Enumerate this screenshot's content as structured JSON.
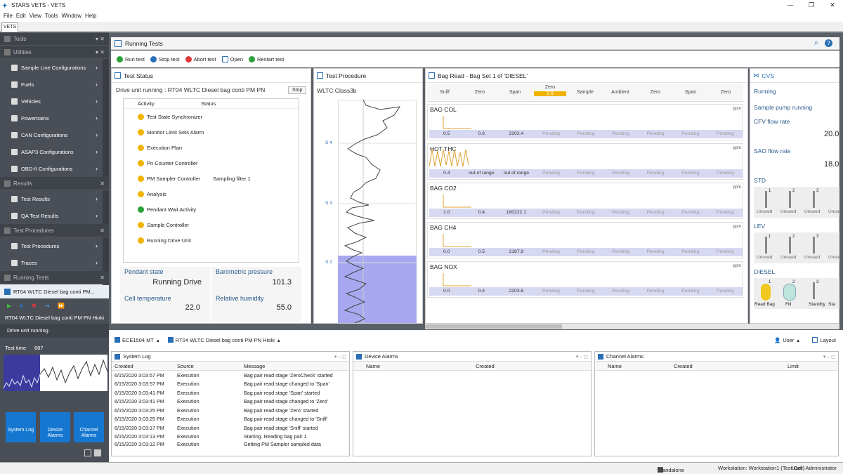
{
  "window": {
    "title": "STARS VETS - VETS",
    "tab": "VETS"
  },
  "menu": [
    "File",
    "Edit",
    "View",
    "Tools",
    "Window",
    "Help"
  ],
  "left": {
    "tools_header": "Tools",
    "utilities_header": "Utilities",
    "utilities": [
      "Sample Line Configurations",
      "Fuels",
      "Vehicles",
      "Powertrains",
      "CAN Configurations",
      "ASAP3 Configurations",
      "OBD-II Configurations"
    ],
    "results_header": "Results",
    "results": [
      "Test Results",
      "QA Test Results"
    ],
    "procedures_header": "Test Procedures",
    "procedures": [
      "Test Procedures",
      "Traces"
    ],
    "running_header": "Running Tests",
    "running_item": "RT04 WLTC Diesel bag conti PM...",
    "running_title": "RT04 WLTC Diesel bag conti PM PN Hioki",
    "drive_status": "Drive unit running",
    "test_time_label": "Test time",
    "test_time_value": "687",
    "buttons": {
      "system_log": "System Log",
      "device_alarms": "Device Alarms",
      "channel_alarms": "Channel Alarms"
    }
  },
  "running": {
    "title": "Running Tests",
    "toolbar": {
      "run": "Run test",
      "stop": "Stop test",
      "abort": "Abort test",
      "open": "Open",
      "restart": "Restart test"
    }
  },
  "test_status": {
    "title": "Test Status",
    "headline": "Drive unit running : RT04 WLTC Diesel bag conti PM PN",
    "stop_label": "Stop",
    "col_activity": "Activity",
    "col_status": "Status",
    "activities": [
      {
        "name": "Test State Synchronizer",
        "status": ""
      },
      {
        "name": "Monitor Limit Sets Alarm",
        "status": ""
      },
      {
        "name": "Execution Plan",
        "status": ""
      },
      {
        "name": "Pn Counter Controller",
        "status": ""
      },
      {
        "name": "PM Sampler Controller",
        "status": "Sampling filter 1"
      },
      {
        "name": "Analysis",
        "status": ""
      },
      {
        "name": "Pendant Wait Activity",
        "status": ""
      },
      {
        "name": "Sample Controller",
        "status": ""
      },
      {
        "name": "Running Drive Unit",
        "status": ""
      }
    ],
    "pendant_label": "Pendant state",
    "pendant_value": "Running Drive",
    "baro_label": "Barometric pressure",
    "baro_value": "101.3",
    "cell_temp_label": "Cell temperature",
    "cell_temp_value": "22.0",
    "humidity_label": "Relative humidity",
    "humidity_value": "55.0"
  },
  "procedure": {
    "title": "Test Procedure",
    "cycle": "WLTC Class3b",
    "markers": [
      "S 4",
      "S 3",
      "S 2"
    ]
  },
  "bag_read": {
    "title": "Bag Read - Bag Set 1 of 'DIESEL'",
    "columns": [
      "Sniff",
      "Zero",
      "Span",
      "Zero",
      "Sample",
      "Ambient",
      "Zero",
      "Span",
      "Zero"
    ],
    "active_badge": "2.9",
    "unit": "ppm",
    "rows": [
      {
        "name": "BAG COL",
        "values": [
          "0.5",
          "0.6",
          "2202.4",
          "Pending",
          "Pending",
          "Pending",
          "Pending",
          "Pending",
          "Pending"
        ]
      },
      {
        "name": "HOT THC",
        "values": [
          "0.4",
          "out of range",
          "out of range",
          "Pending",
          "Pending",
          "Pending",
          "Pending",
          "Pending",
          "Pending"
        ]
      },
      {
        "name": "BAG CO2",
        "values": [
          "1.0",
          "0.4",
          "180222.1",
          "Pending",
          "Pending",
          "Pending",
          "Pending",
          "Pending",
          "Pending"
        ]
      },
      {
        "name": "BAG CH4",
        "values": [
          "0.0",
          "0.5",
          "2187.9",
          "Pending",
          "Pending",
          "Pending",
          "Pending",
          "Pending",
          "Pending"
        ]
      },
      {
        "name": "BAG NOX",
        "values": [
          "0.0",
          "0.4",
          "2203.8",
          "Pending",
          "Pending",
          "Pending",
          "Pending",
          "Pending",
          "Pending"
        ]
      }
    ]
  },
  "cvs": {
    "title": "CVS",
    "status": "Running",
    "pump": "Sample pump running",
    "cfv_label": "CFV flow rate",
    "cfv_value": "20.0",
    "sao_label": "SAO flow rate",
    "sao_value": "18.0",
    "std_label": "STD",
    "lev_label": "LEV",
    "diesel_label": "DIESEL",
    "unused": "Unused",
    "slot_numbers": [
      "1",
      "2",
      "3"
    ],
    "diesel_bags": [
      "Read Bag",
      "Fill",
      "Standby",
      "Sta"
    ]
  },
  "bottom": {
    "ece": "ECE1504 MT",
    "test": "RT04 WLTC Diesel bag conti PM PN Hioki",
    "user": "User",
    "layout": "Layout"
  },
  "system_log": {
    "title": "System Log",
    "cols": [
      "Created",
      "Source",
      "Message"
    ],
    "rows": [
      [
        "6/15/2020 3:03:57 PM",
        "Execution",
        "Bag pair read stage 'ZeroCheck' started"
      ],
      [
        "6/15/2020 3:03:57 PM",
        "Execution",
        "Bag pair read stage changed to 'Span'"
      ],
      [
        "6/15/2020 3:03:41 PM",
        "Execution",
        "Bag pair read stage 'Span' started"
      ],
      [
        "6/15/2020 3:03:41 PM",
        "Execution",
        "Bag pair read stage changed to 'Zero'"
      ],
      [
        "6/15/2020 3:03:25 PM",
        "Execution",
        "Bag pair read stage 'Zero' started"
      ],
      [
        "6/15/2020 3:03:25 PM",
        "Execution",
        "Bag pair read stage changed to 'Sniff'"
      ],
      [
        "6/15/2020 3:03:17 PM",
        "Execution",
        "Bag pair read stage 'Sniff' started"
      ],
      [
        "6/15/2020 3:03:13 PM",
        "Execution",
        "Starting. Reading bag pair 1"
      ],
      [
        "6/15/2020 3:03:12 PM",
        "Execution",
        "Getting PM Sampler sampled data"
      ]
    ]
  },
  "device_alarms": {
    "title": "Device Alarms",
    "cols": [
      "Name",
      "Created"
    ]
  },
  "channel_alarms": {
    "title": "Channel Alarms",
    "cols": [
      "Name",
      "Created",
      "Limit"
    ]
  },
  "status_bar": {
    "mode": "Standalone",
    "workstation": "Workstation: Workstation1 (Test Cell)",
    "user": "User: Administrator"
  }
}
